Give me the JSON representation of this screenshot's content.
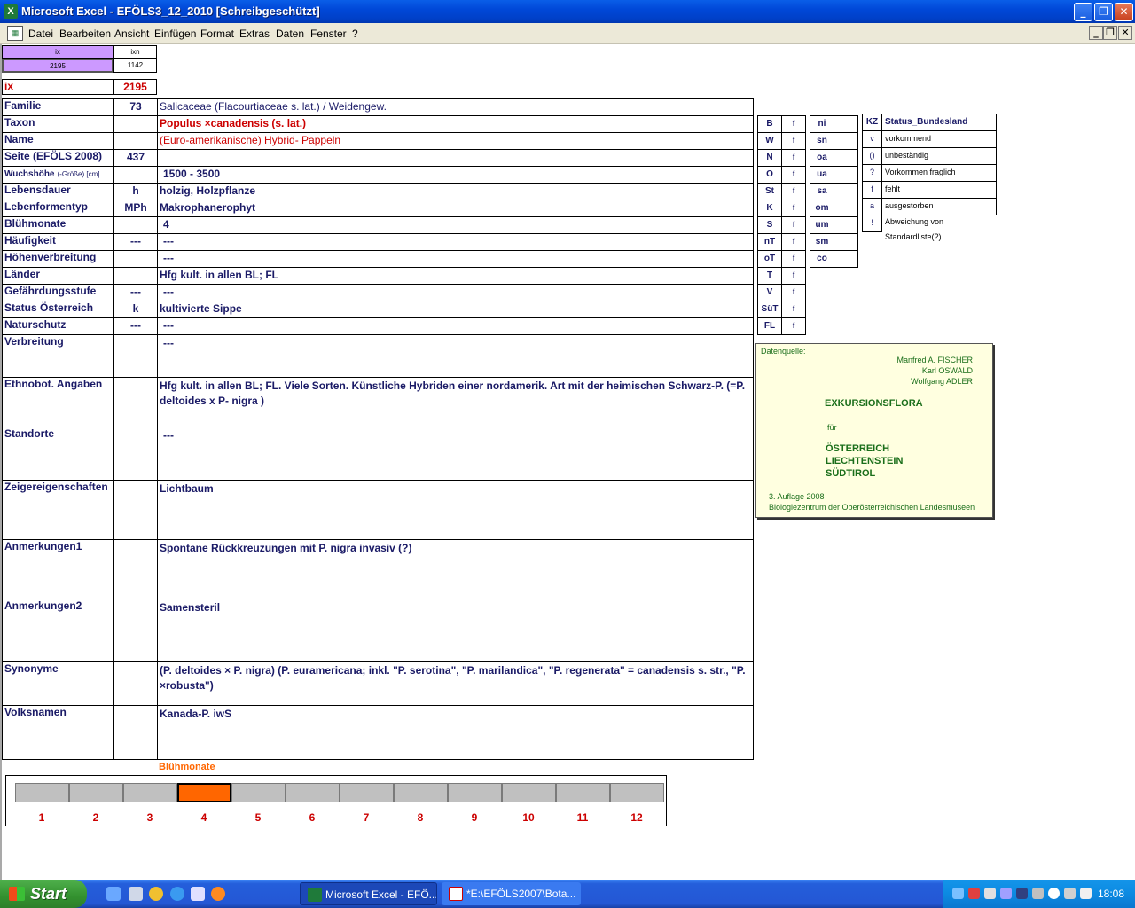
{
  "window": {
    "title": "Microsoft Excel - EFÖLS3_12_2010  [Schreibgeschützt]"
  },
  "menu": [
    "Datei",
    "Bearbeiten",
    "Ansicht",
    "Einfügen",
    "Format",
    "Extras",
    "Daten",
    "Fenster",
    "?"
  ],
  "header": {
    "ix_head": "ix",
    "ixn_head": "ixn",
    "ix_val": "2195",
    "ixn_val": "1142",
    "ix_label": "ix",
    "ix_big": "2195"
  },
  "rows": [
    {
      "label": "Familie",
      "code": "73",
      "value": "Salicaceae (Flacourtiaceae s. lat.)  /  Weidengew."
    },
    {
      "label": "Taxon",
      "code": "",
      "value": "Populus ×canadensis (s. lat.)"
    },
    {
      "label": "Name",
      "code": "",
      "value": "(Euro-amerikanische) Hybrid- Pappeln"
    },
    {
      "label": "Seite (EFÖLS 2008)",
      "code": "437",
      "value": ""
    },
    {
      "label": "Wuchshöhe",
      "label_small": "(-Größe) [cm]",
      "code": "",
      "value": "1500 - 3500"
    },
    {
      "label": "Lebensdauer",
      "code": "h",
      "value": "holzig, Holzpflanze"
    },
    {
      "label": "Lebenformentyp",
      "code": "MPh",
      "value": "Makrophanerophyt"
    },
    {
      "label": "Blühmonate",
      "code": "",
      "value": "4"
    },
    {
      "label": "Häufigkeit",
      "code": "---",
      "value": "---"
    },
    {
      "label": "Höhenverbreitung",
      "code": "",
      "value": "---"
    },
    {
      "label": "Länder",
      "code": "",
      "value": "Hfg kult. in allen BL; FL"
    },
    {
      "label": "Gefährdungsstufe",
      "code": "---",
      "value": "---"
    },
    {
      "label": "Status Österreich",
      "code": "k",
      "value": "kultivierte Sippe"
    },
    {
      "label": "Naturschutz",
      "code": "---",
      "value": "---"
    },
    {
      "label": "Verbreitung",
      "code": "",
      "value": "---"
    },
    {
      "label": "Ethnobot. Angaben",
      "code": "",
      "value": "Hfg kult. in allen BL; FL. Viele Sorten. Künstliche Hybriden einer nordamerik. Art mit der heimischen Schwarz-P. (=P. deltoides x P- nigra )"
    },
    {
      "label": "Standorte",
      "code": "",
      "value": "---"
    },
    {
      "label": "Zeigereigenschaften",
      "code": "",
      "value": "Lichtbaum"
    },
    {
      "label": "Anmerkungen1",
      "code": "",
      "value": "Spontane Rückkreuzungen mit P. nigra invasiv (?)"
    },
    {
      "label": "Anmerkungen2",
      "code": "",
      "value": "Samensteril"
    },
    {
      "label": "Synonyme",
      "code": "",
      "value": "(P. deltoides × P. nigra) (P. euramericana; inkl. \"P. serotina\", \"P. marilandica\", \"P. regenerata\" = canadensis s. str., \"P. ×robusta\")"
    },
    {
      "label": "Volksnamen",
      "code": "",
      "value": "Kanada-P. iwS"
    }
  ],
  "regions_left": [
    {
      "code": "B",
      "flag": "f"
    },
    {
      "code": "W",
      "flag": "f"
    },
    {
      "code": "N",
      "flag": "f"
    },
    {
      "code": "O",
      "flag": "f"
    },
    {
      "code": "St",
      "flag": "f"
    },
    {
      "code": "K",
      "flag": "f"
    },
    {
      "code": "S",
      "flag": "f"
    },
    {
      "code": "nT",
      "flag": "f"
    },
    {
      "code": "oT",
      "flag": "f"
    },
    {
      "code": "T",
      "flag": "f"
    },
    {
      "code": "V",
      "flag": "f"
    },
    {
      "code": "SüT",
      "flag": "f"
    },
    {
      "code": "FL",
      "flag": "f"
    }
  ],
  "regions_mid": [
    "ni",
    "sn",
    "oa",
    "ua",
    "sa",
    "om",
    "um",
    "sm",
    "co"
  ],
  "status_legend": {
    "head_kz": "KZ",
    "head_label": "Status_Bundesland",
    "items": [
      {
        "kz": "v",
        "label": "vorkommend"
      },
      {
        "kz": "()",
        "label": "unbeständig"
      },
      {
        "kz": "?",
        "label": "Vorkommen fraglich"
      },
      {
        "kz": "f",
        "label": "fehlt"
      },
      {
        "kz": "a",
        "label": "ausgestorben"
      },
      {
        "kz": "!",
        "label": "Abweichung von Standardliste(?)"
      }
    ]
  },
  "datenquelle": {
    "label": "Datenquelle:",
    "authors": [
      "Manfred A. FISCHER",
      "Karl OSWALD",
      "Wolfgang ADLER"
    ],
    "title": "EXKURSIONSFLORA",
    "fuer": "für",
    "countries": [
      "ÖSTERREICH",
      "LIECHTENSTEIN",
      "SÜDTIROL"
    ],
    "edition": "3. Auflage 2008",
    "publisher": "Biologiezentrum der Oberösterreichischen Landesmuseen"
  },
  "bluehmonate": {
    "title": "Blühmonate",
    "months": [
      "1",
      "2",
      "3",
      "4",
      "5",
      "6",
      "7",
      "8",
      "9",
      "10",
      "11",
      "12"
    ],
    "active": [
      4
    ]
  },
  "taskbar": {
    "start": "Start",
    "tasks": [
      "Microsoft Excel - EFÖ...",
      "*E:\\EFÖLS2007\\Bota..."
    ],
    "clock": "18:08"
  },
  "colors": {
    "active_month": "#ff6600",
    "header_purple": "#cc99ff",
    "label_blue": "#1a1a66",
    "red": "#cc0000"
  }
}
